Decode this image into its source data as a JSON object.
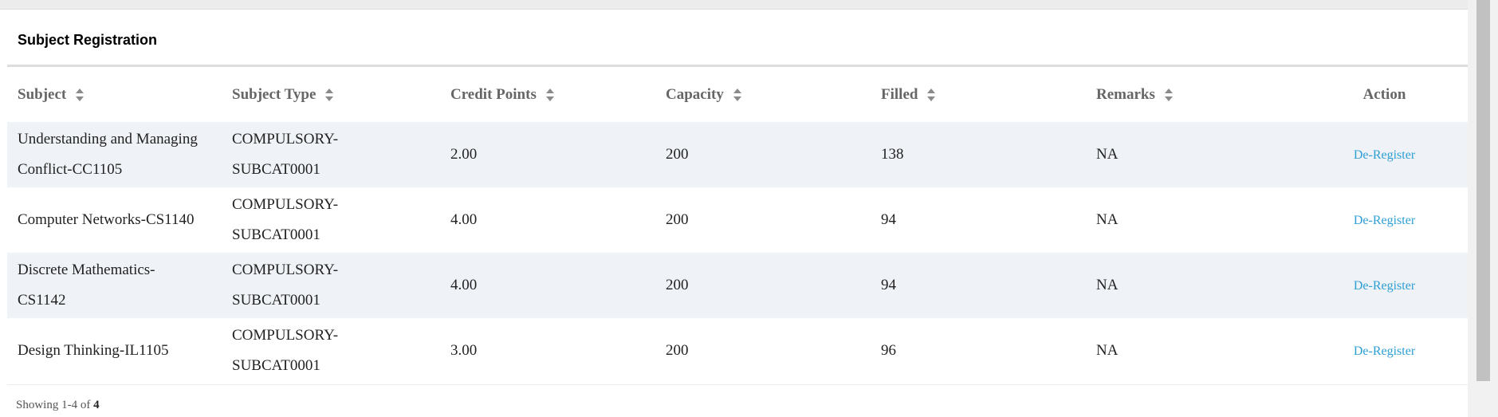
{
  "panel": {
    "title": "Subject Registration"
  },
  "table": {
    "columns": [
      "Subject",
      "Subject Type",
      "Credit Points",
      "Capacity",
      "Filled",
      "Remarks",
      "Action"
    ],
    "rows": [
      {
        "subject_line1": "Understanding and Managing",
        "subject_line2": "Conflict-CC1105",
        "type_line1": "COMPULSORY-",
        "type_line2": "SUBCAT0001",
        "credit": "2.00",
        "capacity": "200",
        "filled": "138",
        "remarks": "NA",
        "action": "De-Register"
      },
      {
        "subject_line1": "Computer Networks-CS1140",
        "subject_line2": "",
        "type_line1": "COMPULSORY-",
        "type_line2": "SUBCAT0001",
        "credit": "4.00",
        "capacity": "200",
        "filled": "94",
        "remarks": "NA",
        "action": "De-Register"
      },
      {
        "subject_line1": "Discrete Mathematics-",
        "subject_line2": "CS1142",
        "type_line1": "COMPULSORY-",
        "type_line2": "SUBCAT0001",
        "credit": "4.00",
        "capacity": "200",
        "filled": "94",
        "remarks": "NA",
        "action": "De-Register"
      },
      {
        "subject_line1": "Design Thinking-IL1105",
        "subject_line2": "",
        "type_line1": "COMPULSORY-",
        "type_line2": "SUBCAT0001",
        "credit": "3.00",
        "capacity": "200",
        "filled": "96",
        "remarks": "NA",
        "action": "De-Register"
      }
    ]
  },
  "footer": {
    "summary_prefix": "Showing 1-4 of",
    "total": "4"
  },
  "icons": {
    "sort": "sort-icon"
  }
}
